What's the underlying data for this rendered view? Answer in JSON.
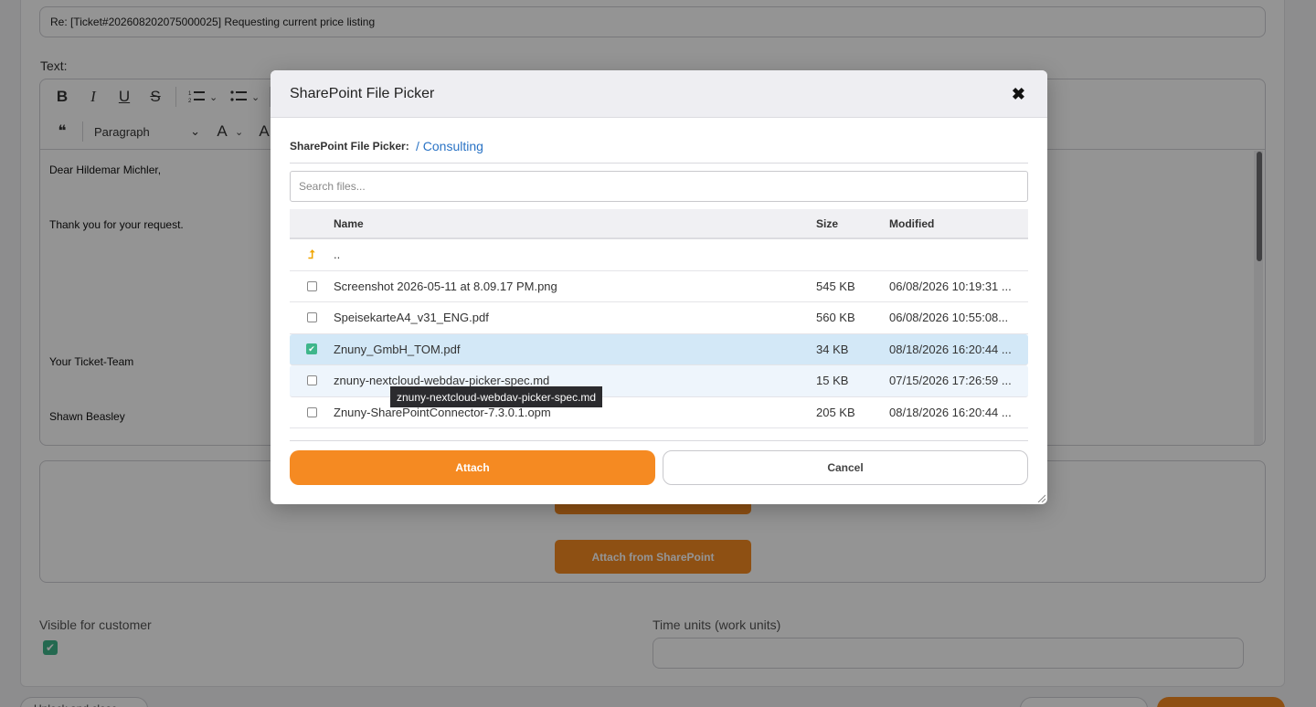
{
  "background": {
    "subject_value": "Re: [Ticket#202608202075000025] Requesting current price listing",
    "text_label": "Text:",
    "editor": {
      "toolbar": {
        "bold": "B",
        "italic": "I",
        "underline": "U",
        "strike": "S",
        "quote": "❝",
        "paragraph_select": "Paragraph",
        "font_size_glyph": "A",
        "chevron": "⌄"
      },
      "body_lines": [
        "Dear Hildemar Michler,",
        "Thank you for your request.",
        "Your Ticket-Team",
        "Shawn Beasley"
      ]
    },
    "attach_from_sharepoint": "Attach from SharePoint",
    "visible_for_customer_label": "Visible for customer",
    "time_units_label": "Time units (work units)",
    "footer_unlock": "Unlock and close"
  },
  "modal": {
    "title": "SharePoint File Picker",
    "close_icon": "✖",
    "breadcrumb_label": "SharePoint File Picker:",
    "breadcrumb_path": "/ Consulting",
    "search_placeholder": "Search files...",
    "columns": {
      "name": "Name",
      "size": "Size",
      "modified": "Modified"
    },
    "up_row": {
      "icon": "⮥",
      "name": ".."
    },
    "files": [
      {
        "name": "Screenshot 2026-05-11 at 8.09.17 PM.png",
        "size": "545 KB",
        "modified": "06/08/2026 10:19:31 ...",
        "checked": false
      },
      {
        "name": "SpeisekarteA4_v31_ENG.pdf",
        "size": "560 KB",
        "modified": "06/08/2026 10:55:08...",
        "checked": false
      },
      {
        "name": "Znuny_GmbH_TOM.pdf",
        "size": "34 KB",
        "modified": "08/18/2026 16:20:44 ...",
        "checked": true
      },
      {
        "name": "znuny-nextcloud-webdav-picker-spec.md",
        "size": "15 KB",
        "modified": "07/15/2026 17:26:59 ...",
        "checked": false
      },
      {
        "name": "Znuny-SharePointConnector-7.3.0.1.opm",
        "size": "205 KB",
        "modified": "08/18/2026 16:20:44 ...",
        "checked": false
      }
    ],
    "tooltip": "znuny-nextcloud-webdav-picker-spec.md",
    "attach_button": "Attach",
    "cancel_button": "Cancel",
    "check_glyph": "✔"
  },
  "colors": {
    "accent_orange": "#f58a22",
    "selected_row": "#d3e8f7",
    "checkbox_green": "#3fb68b",
    "link_blue": "#2a73c5"
  }
}
